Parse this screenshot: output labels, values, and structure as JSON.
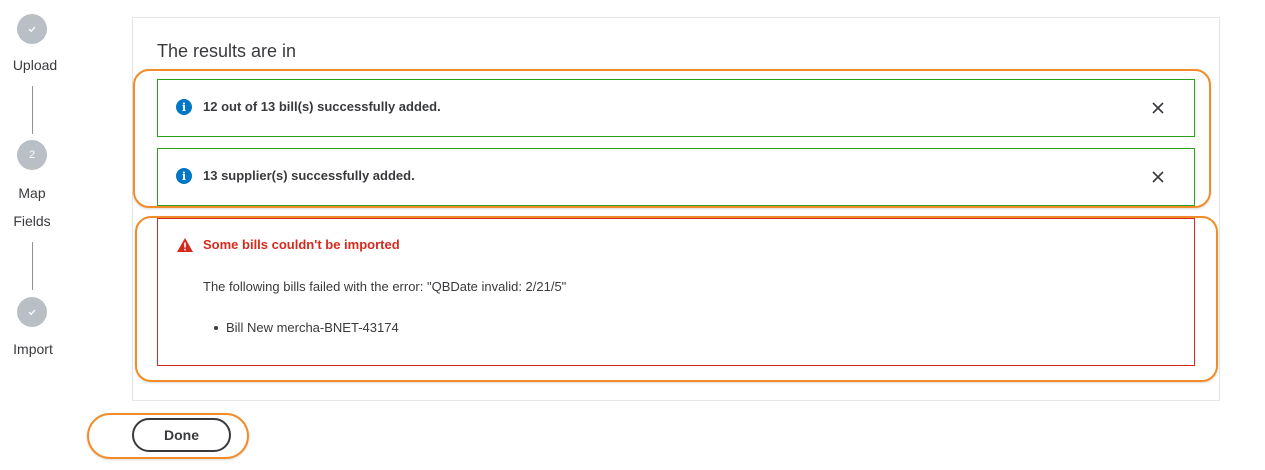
{
  "stepper": {
    "steps": [
      {
        "label": "Upload",
        "number": "",
        "status": "complete"
      },
      {
        "label_line1": "Map",
        "label_line2": "Fields",
        "number": "2",
        "status": "pending"
      },
      {
        "label": "Import",
        "number": "",
        "status": "complete"
      }
    ]
  },
  "results": {
    "title": "The results are in",
    "banners": [
      {
        "type": "success",
        "icon": "info-icon",
        "text": "12 out of 13 bill(s) successfully added."
      },
      {
        "type": "success",
        "icon": "info-icon",
        "text": "13 supplier(s) successfully added."
      }
    ],
    "error": {
      "icon": "warning-icon",
      "title": "Some bills couldn't be imported",
      "description": "The following bills failed with the error: \"QBDate invalid: 2/21/5\"",
      "items": [
        "Bill New mercha-BNET-43174"
      ]
    }
  },
  "footer": {
    "done_label": "Done"
  },
  "colors": {
    "success_border": "#2ca01c",
    "error": "#d52b1e",
    "info_blue": "#0077c5",
    "highlight_orange": "#f28c28",
    "step_circle": "#babec5"
  }
}
